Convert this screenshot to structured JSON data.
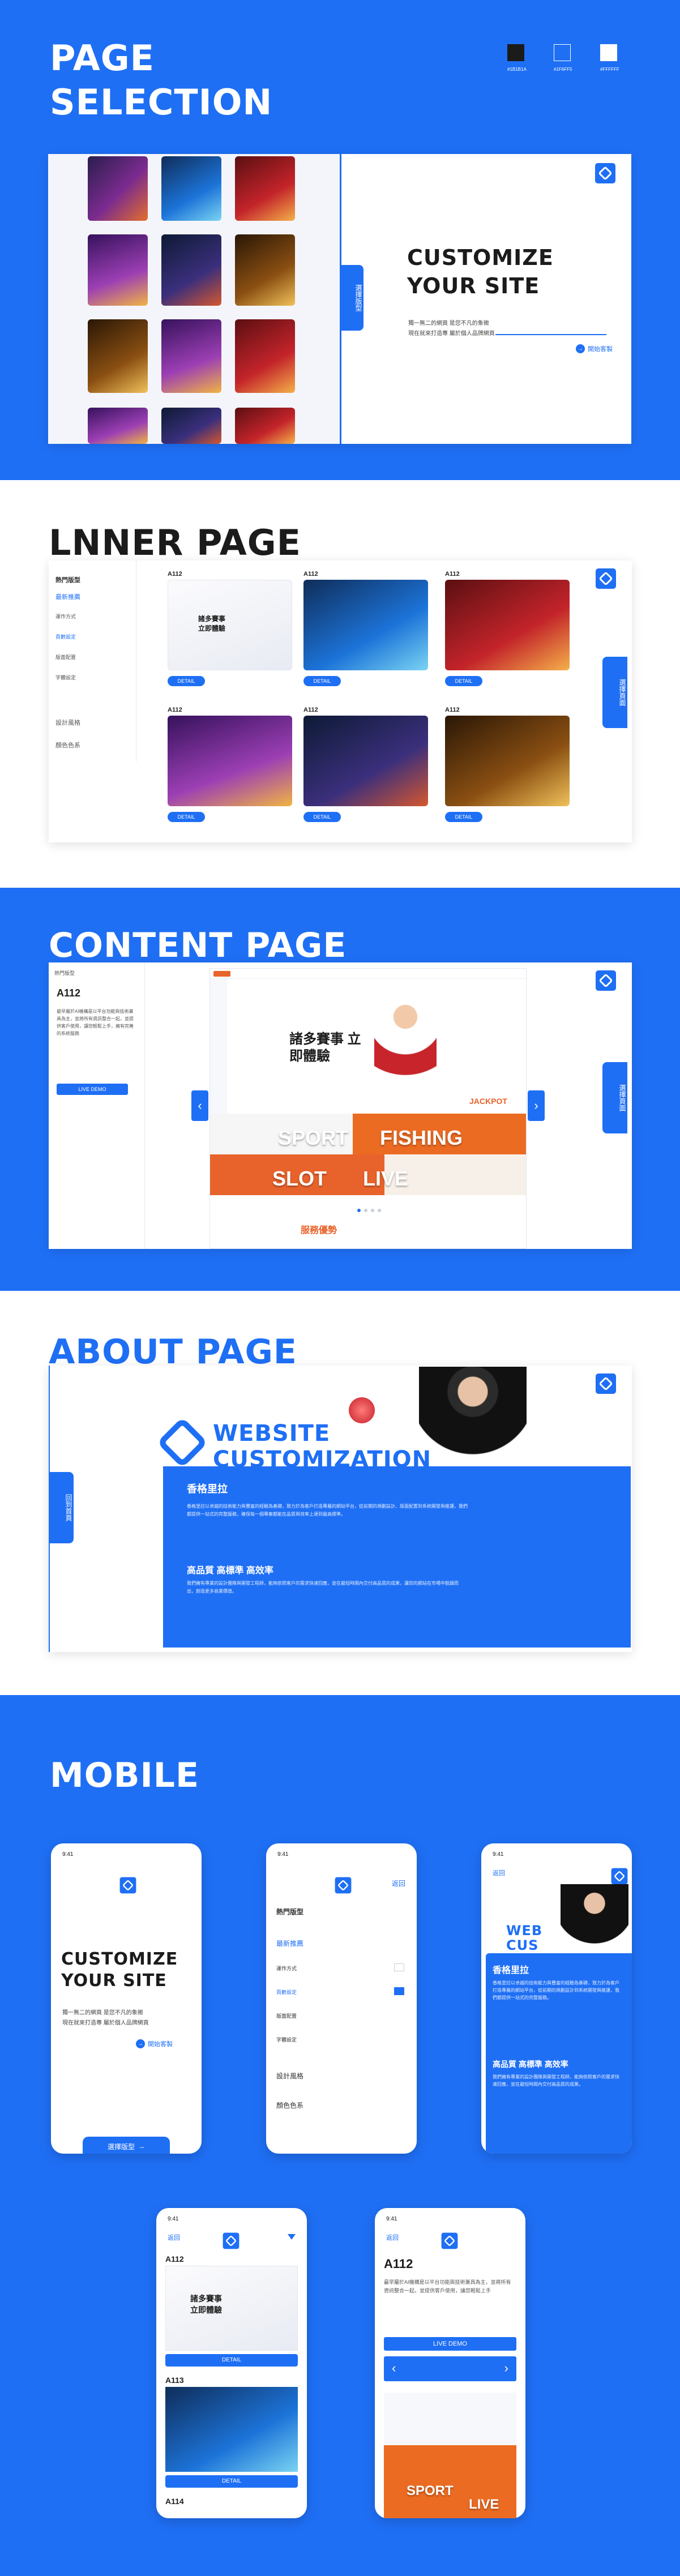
{
  "colors": {
    "brand_blue": "#1f6ff5",
    "dark": "#1b1b1b",
    "light_blue": "#1f6ff5",
    "white": "#ffffff"
  },
  "palette": {
    "swatch_labels": [
      "#1B1B1A",
      "#1F6FF5",
      "#FFFFFF"
    ]
  },
  "page_selection": {
    "heading_line1": "PAGE",
    "heading_line2": "SELECTION",
    "customize_line1": "CUSTOMIZE",
    "customize_line2": "YOUR SITE",
    "subtitle_line1": "獨一無二的網頁 是您不凡的象徵",
    "subtitle_line2": "現在就來打造專 屬於個人品牌網頁",
    "start_link": "開始客製",
    "side_tab": "選擇版型"
  },
  "inner_page": {
    "heading": "LNNER PAGE",
    "menu_title": "熱門版型",
    "menu_items": [
      "最新推薦",
      "運作方式",
      "頁數設定",
      "版面配置",
      "字體設定",
      "設計風格",
      "顏色色系"
    ],
    "card_code": "A112",
    "card_detail": "DETAIL",
    "card_banner": "諸多賽事 立即體驗",
    "side_tab": "選擇頁面"
  },
  "content_page": {
    "heading": "CONTENT PAGE",
    "menu_title": "熱門版型",
    "code": "A112",
    "description": "最早屬於AI機構是以平台功能與技術兼具為主，並將所有資訊整合一起，並提供客戶使用，讓您輕鬆上手，擁有完善的系統服務",
    "live_demo": "LIVE DEMO",
    "banner_title": "諸多賽事 立即體驗",
    "banner_sport": "SPORT",
    "banner_fishing": "FISHING",
    "banner_slot": "SLOT",
    "banner_live": "LIVE",
    "banner_jackpot": "JACKPOT",
    "service_label": "服務優勢",
    "side_tab": "選擇頁面"
  },
  "about_page": {
    "heading": "ABOUT PAGE",
    "brand_line1": "WEBSITE",
    "brand_line2": "CUSTOMIZATION",
    "company_name": "香格里拉",
    "company_text": "香格里拉以卓越的技術能力與豐富的經驗為基礎，致力於為客戶打造專屬的網站平台，從前期的規劃設計、版面配置到系統開發與維護，我們都提供一站式的完整服務，確保每一個專案都能在品質與效率上達到最高標準。",
    "quality_title": "高品質 高標準 高效率",
    "quality_text": "我們擁有專業的設計團隊與開發工程師，能夠依照客戶的需求快速回應，並在最短時間內交付高品質的成果，讓您的網站在市場中脫穎而出，創造更多商業價值。",
    "side_tab": "回到首頁"
  },
  "mobile": {
    "heading": "MOBILE",
    "status_time": "9:41",
    "customize_line1": "CUSTOMIZE",
    "customize_line2": "YOUR SITE",
    "subtitle_line1": "獨一無二的網頁 是您不凡的象徵",
    "subtitle_line2": "現在就來打造專 屬於個人品牌網頁",
    "start_link": "開始客製",
    "bottom_button": "選擇版型",
    "menu_back": "返回",
    "menu_title": "熱門版型",
    "menu_items": [
      "最新推薦",
      "運作方式",
      "頁數設定",
      "版面配置",
      "字體設定",
      "設計風格",
      "顏色色系"
    ],
    "about_back": "返回",
    "about_brand1": "WEB",
    "about_brand2": "CUS",
    "about_company": "香格里拉",
    "about_text": "香格里拉以卓越的技術能力與豐富的經驗為基礎，致力於為客戶打造專屬的網站平台，從前期的規劃設計到系統開發與維護，我們都提供一站式的完整服務。",
    "about_quality": "高品質 高標準 高效率",
    "about_quality_text": "我們擁有專業的設計團隊與開發工程師，能夠依照客戶的需求快速回應，並在最短時間內交付高品質的成果。",
    "list_back": "返回",
    "list_code1": "A112",
    "list_code2": "A113",
    "list_code3": "A114",
    "list_detail": "DETAIL",
    "list_banner": "諸多賽事 立即體驗",
    "detail_back": "返回",
    "detail_code": "A112",
    "detail_text": "最早屬於AI機構是以平台功能與技術兼具為主，並將所有資訊整合一起，並提供客戶使用，讓您輕鬆上手",
    "detail_live_demo": "LIVE DEMO",
    "detail_banner_sport": "SPORT",
    "detail_banner_live": "LIVE"
  }
}
